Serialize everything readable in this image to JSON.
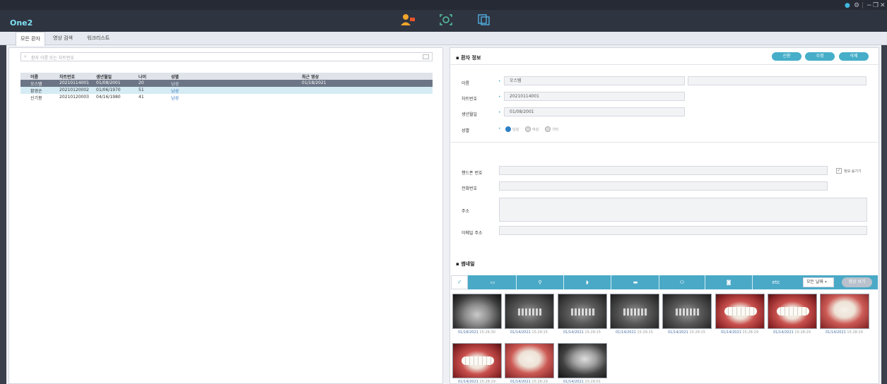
{
  "app": {
    "title": "One2",
    "window_controls": [
      "●",
      "⚙",
      "|",
      "−",
      "❐",
      "✕"
    ]
  },
  "tabs": [
    {
      "label": "모든 환자",
      "active": true
    },
    {
      "label": "영상 검색",
      "active": false
    },
    {
      "label": "워크리스트",
      "active": false
    }
  ],
  "search": {
    "placeholder": "환자 이름 또는 차트번호"
  },
  "patient_table": {
    "headers": [
      "이름",
      "차트번호",
      "생년월일",
      "나이",
      "성별",
      "최근 영상"
    ],
    "rows": [
      {
        "name": "오스템",
        "chart": "20210114001",
        "dob": "01/08/2001",
        "age": "20",
        "sex": "남성",
        "recent": "01/18/2021"
      },
      {
        "name": "황영순",
        "chart": "20210120002",
        "dob": "01/06/1970",
        "age": "51",
        "sex": "남성",
        "recent": ""
      },
      {
        "name": "신기봉",
        "chart": "20210120003",
        "dob": "04/16/1980",
        "age": "41",
        "sex": "남성",
        "recent": ""
      }
    ]
  },
  "patient_info": {
    "title": "환자 정보",
    "buttons": {
      "new": "신환",
      "edit": "수정",
      "delete": "삭제"
    },
    "labels": {
      "name": "이름",
      "chart": "차트번호",
      "dob": "생년월일",
      "sex": "성별",
      "mobile": "핸드폰 번호",
      "phone": "전화번호",
      "address": "주소",
      "email": "이메일 주소"
    },
    "values": {
      "name": "오스템",
      "chart": "20210114001",
      "dob": "01/08/2001"
    },
    "sex_options": [
      "남성",
      "여성",
      "기타"
    ],
    "hide_info_label": "정보 숨기기"
  },
  "thumbnails": {
    "title": "썸네일",
    "toolbar_etc": "etc",
    "date_filter": "모든 날짜",
    "view_button": "영상 보기",
    "items": [
      {
        "date": "01/18/2021",
        "time": "15:26:30",
        "kind": "pa"
      },
      {
        "date": "01/14/2021",
        "time": "15:29:15",
        "kind": "pano"
      },
      {
        "date": "01/14/2021",
        "time": "15:29:15",
        "kind": "pano"
      },
      {
        "date": "01/14/2021",
        "time": "15:29:15",
        "kind": "pano"
      },
      {
        "date": "01/14/2021",
        "time": "15:29:15",
        "kind": "pano"
      },
      {
        "date": "01/14/2021",
        "time": "15:28:29",
        "kind": "intra"
      },
      {
        "date": "01/14/2021",
        "time": "15:28:29",
        "kind": "intra"
      },
      {
        "date": "01/14/2021",
        "time": "15:28:29",
        "kind": "intra-occ"
      },
      {
        "date": "01/14/2021",
        "time": "15:28:29",
        "kind": "intra"
      },
      {
        "date": "01/14/2021",
        "time": "15:28:29",
        "kind": "intra-occ"
      },
      {
        "date": "01/14/2021",
        "time": "15:29:01",
        "kind": "ceph"
      }
    ]
  }
}
